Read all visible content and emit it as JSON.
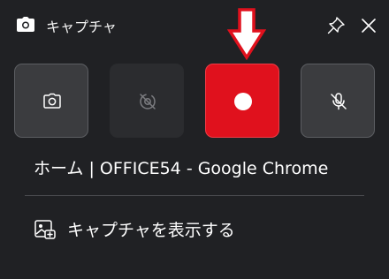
{
  "header": {
    "title": "キャプチャ",
    "app_icon": "camera-icon",
    "pin_icon": "pin-icon",
    "close_icon": "close-icon"
  },
  "capture_buttons": [
    {
      "name": "screenshot",
      "icon": "camera-icon"
    },
    {
      "name": "record-off",
      "icon": "record-off-icon",
      "state": "disabled"
    },
    {
      "name": "record",
      "icon": "record-dot-icon",
      "state": "active"
    },
    {
      "name": "mic",
      "icon": "mic-off-icon",
      "state": "muted"
    }
  ],
  "annotation": {
    "icon": "arrow-down-icon",
    "color": "#e0111d"
  },
  "target_window": "ホーム | OFFICE54 - Google Chrome",
  "show_captures": {
    "label": "キャプチャを表示する",
    "icon": "gallery-icon"
  },
  "colors": {
    "background": "#202124",
    "button": "#3b3c3f",
    "record_accent": "#e0111d"
  }
}
